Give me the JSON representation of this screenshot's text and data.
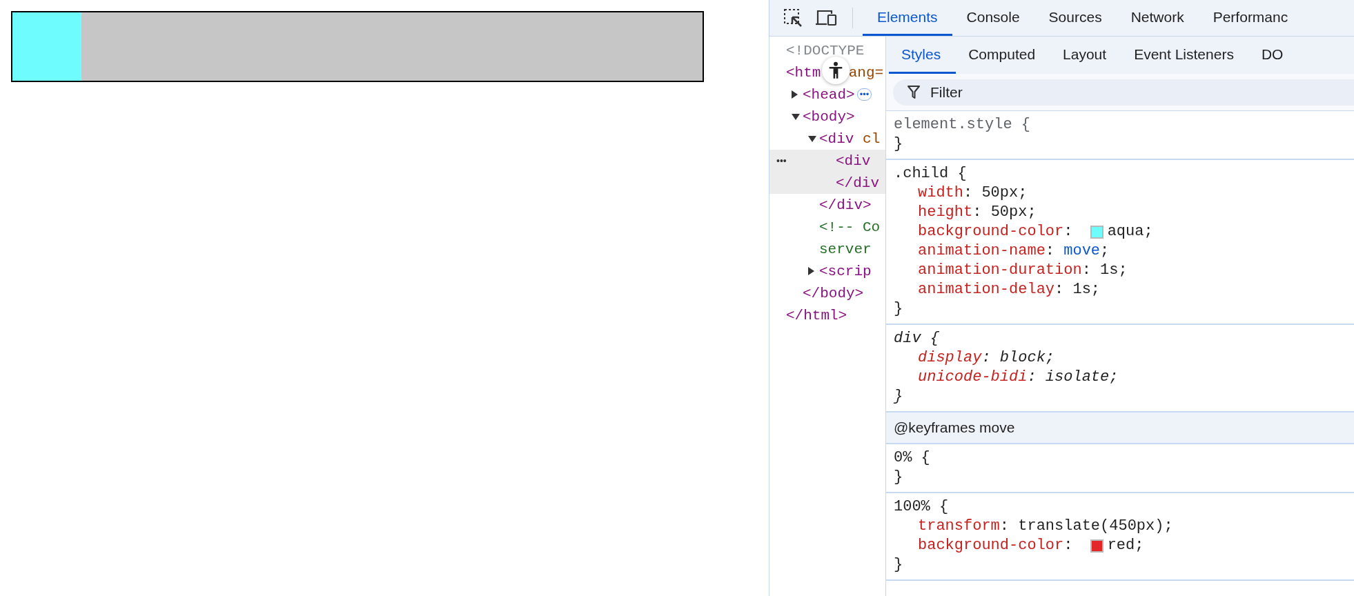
{
  "devtools": {
    "tabs": [
      {
        "label": "Elements",
        "selected": true
      },
      {
        "label": "Console",
        "selected": false
      },
      {
        "label": "Sources",
        "selected": false
      },
      {
        "label": "Network",
        "selected": false
      },
      {
        "label": "Performanc",
        "selected": false
      }
    ],
    "dom_tree": [
      {
        "kind": "doctype",
        "text": "<!DOCTYPE",
        "selected": false
      },
      {
        "kind": "tag",
        "text": "<htm",
        "attr": "ang=",
        "selected": false,
        "children": [
          {
            "kind": "tag",
            "text": "<head>",
            "expanded": false,
            "badge": "•••",
            "selected": false
          },
          {
            "kind": "tag",
            "text": "<body>",
            "expanded": true,
            "selected": false,
            "close": "</body>",
            "children": [
              {
                "kind": "tag",
                "text": "<div",
                "attr": "cl",
                "expanded": true,
                "selected": false,
                "close": "</div>",
                "children": [
                  {
                    "kind": "tag",
                    "text": "<div",
                    "close": "</div",
                    "selected": true,
                    "gutter": "•••"
                  }
                ]
              },
              {
                "kind": "comment",
                "text": "<!-- Co",
                "close": "server",
                "selected": false
              },
              {
                "kind": "tag",
                "text": "<scrip",
                "expanded": false,
                "selected": false
              }
            ]
          }
        ],
        "close": "</html>"
      }
    ],
    "style_tabs": [
      {
        "label": "Styles",
        "selected": true
      },
      {
        "label": "Computed",
        "selected": false
      },
      {
        "label": "Layout",
        "selected": false
      },
      {
        "label": "Event Listeners",
        "selected": false
      },
      {
        "label": "DO",
        "selected": false
      }
    ],
    "filter": {
      "placeholder": "Filter"
    },
    "rules": [
      {
        "kind": "rule",
        "dimmed": true,
        "italic": false,
        "selector": "element.style",
        "open": "{",
        "close": "}"
      },
      {
        "kind": "rule",
        "dimmed": false,
        "italic": false,
        "selector": ".child",
        "open": "{",
        "close": "}",
        "declarations": [
          {
            "property": "width",
            "separator": ":",
            "value": "50px;"
          },
          {
            "property": "height",
            "separator": ":",
            "value": "50px;"
          },
          {
            "property": "background-color",
            "separator": ":",
            "value": "aqua;",
            "color": "#6ffcfd"
          },
          {
            "property": "animation-name",
            "separator": ":",
            "value": "move",
            "link": true,
            "end": ";"
          },
          {
            "property": "animation-duration",
            "separator": ":",
            "value": "1s;"
          },
          {
            "property": "animation-delay",
            "separator": ":",
            "value": "1s;"
          }
        ]
      },
      {
        "kind": "rule",
        "dimmed": false,
        "italic": true,
        "selector": "div",
        "open": "{",
        "close": "}",
        "declarations": [
          {
            "property": "display",
            "separator": ":",
            "value": "block;"
          },
          {
            "property": "unicode-bidi",
            "separator": ":",
            "value": "isolate;"
          }
        ]
      },
      {
        "kind": "heading",
        "text": "@keyframes move"
      },
      {
        "kind": "rule",
        "dimmed": false,
        "italic": false,
        "selector": "0%",
        "open": "{",
        "close": "}"
      },
      {
        "kind": "rule",
        "dimmed": false,
        "italic": false,
        "selector": "100%",
        "open": "{",
        "close": "}",
        "declarations": [
          {
            "property": "transform",
            "separator": ":",
            "value": "translate(450px);"
          },
          {
            "property": "background-color",
            "separator": ":",
            "value": "red;",
            "color": "#e3262a"
          }
        ]
      }
    ]
  }
}
